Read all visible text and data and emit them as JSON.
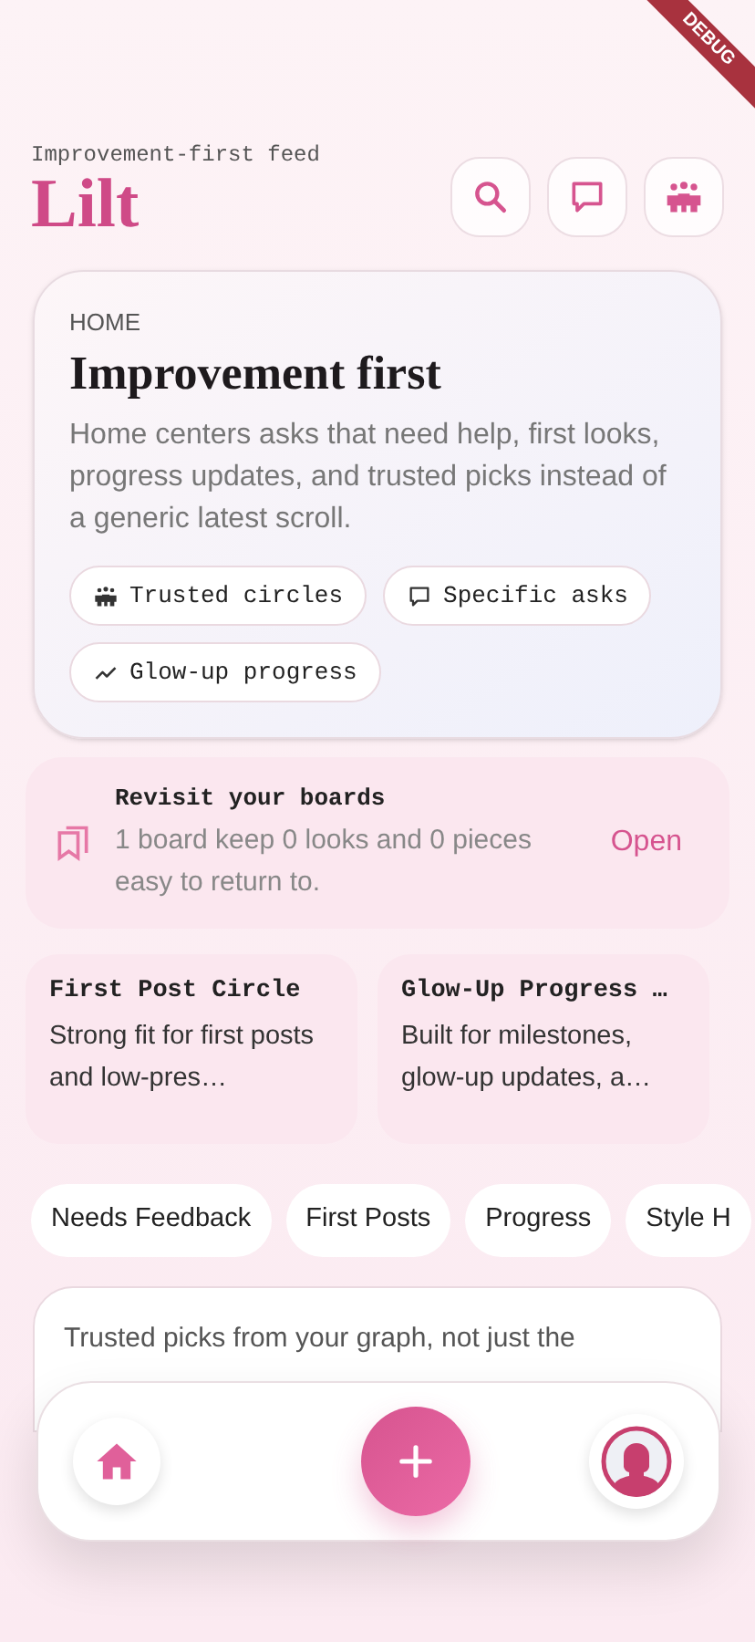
{
  "debug_banner": "DEBUG",
  "header": {
    "subtitle": "Improvement-first feed",
    "title": "Lilt",
    "actions": [
      {
        "kind": "search"
      },
      {
        "kind": "chat"
      },
      {
        "kind": "people"
      }
    ]
  },
  "hero": {
    "eyebrow": "HOME",
    "title": "Improvement first",
    "body": "Home centers asks that need help, first looks, progress updates, and trusted picks instead of a generic latest scroll.",
    "tags": [
      {
        "kind": "people",
        "label": "Trusted circles"
      },
      {
        "kind": "chat",
        "label": "Specific asks"
      },
      {
        "kind": "trend",
        "label": "Glow-up progress"
      }
    ]
  },
  "boards": {
    "title": "Revisit your boards",
    "body": "1 board keep 0 looks and 0 pieces easy to return to.",
    "action": "Open"
  },
  "circles": [
    {
      "title": "First Post Circle",
      "body": "Strong fit for first posts and low-pres…"
    },
    {
      "title": "Glow-Up Progress …",
      "body": "Built for milestones, glow-up updates, a…"
    }
  ],
  "filters": [
    "Needs Feedback",
    "First Posts",
    "Progress",
    "Style H"
  ],
  "feed_card": {
    "text": "Trusted picks from your graph, not just the"
  },
  "nav": [
    {
      "kind": "home"
    },
    {
      "kind": "create"
    },
    {
      "kind": "profile"
    }
  ]
}
